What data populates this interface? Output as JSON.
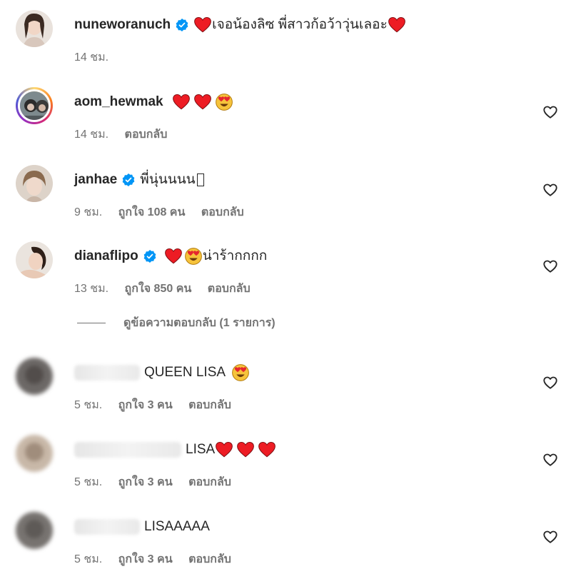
{
  "comments": [
    {
      "username": "nuneworanuch",
      "verified": true,
      "text": "เจอน้องลิซ พี่สาวก้อว้าวุ่นเลอะ",
      "time": "14 ชม.",
      "likes": "",
      "reply": "",
      "liked_icon": "heart-outline-icon"
    },
    {
      "username": "aom_hewmak",
      "verified": false,
      "text": "",
      "time": "14 ชม.",
      "likes": "",
      "reply": "ตอบกลับ"
    },
    {
      "username": "janhae",
      "verified": true,
      "text": "พี่นุ่นนนน",
      "time": "9 ชม.",
      "likes": "ถูกใจ 108 คน",
      "reply": "ตอบกลับ"
    },
    {
      "username": "dianaflipo",
      "verified": true,
      "text": "น่าร้ากกกก",
      "time": "13 ชม.",
      "likes": "ถูกใจ 850 คน",
      "reply": "ตอบกลับ"
    },
    {
      "username": "",
      "verified": false,
      "text": "QUEEN LISA",
      "time": "5 ชม.",
      "likes": "ถูกใจ 3 คน",
      "reply": "ตอบกลับ"
    },
    {
      "username": "",
      "verified": false,
      "text": "LISA",
      "time": "5 ชม.",
      "likes": "ถูกใจ 3 คน",
      "reply": "ตอบกลับ"
    },
    {
      "username": "",
      "verified": false,
      "text": "LISAAAAA",
      "time": "5 ชม.",
      "likes": "ถูกใจ 3 คน",
      "reply": "ตอบกลับ"
    }
  ],
  "view_replies": "ดูข้อความตอบกลับ (1 รายการ)",
  "colors": {
    "verified_blue": "#0095f6",
    "heart_red": "#ed1c24",
    "meta_gray": "#737373",
    "text_dark": "#262626"
  }
}
